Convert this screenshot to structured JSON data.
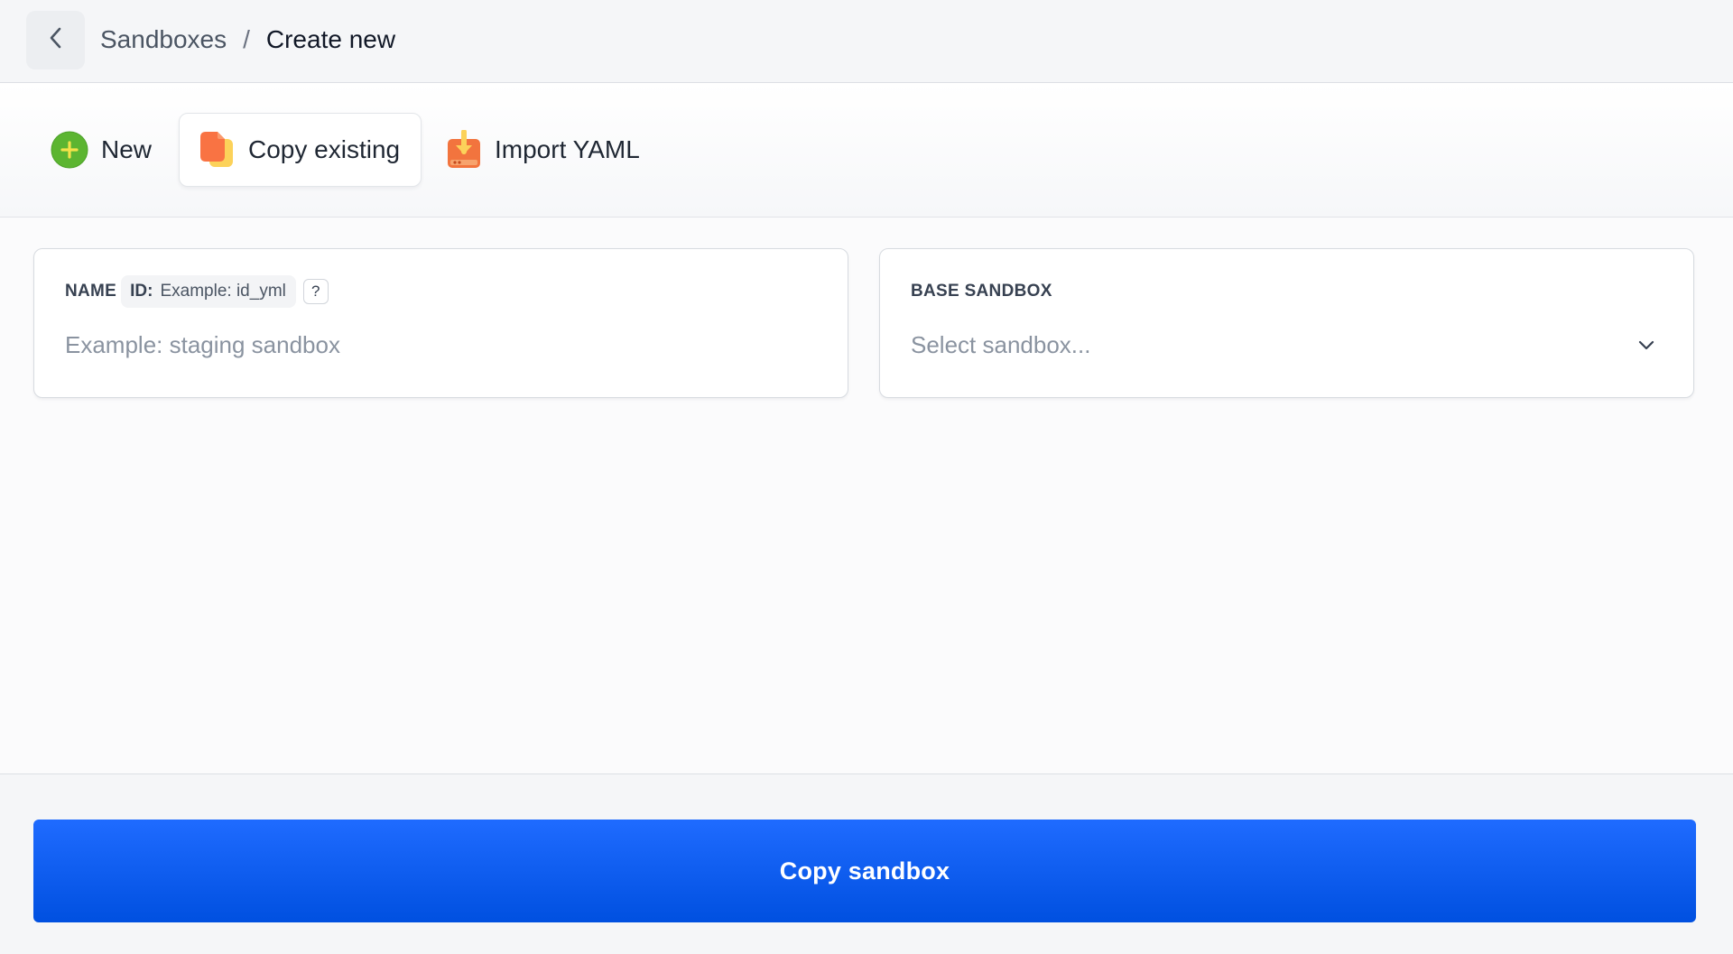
{
  "breadcrumb": {
    "parent": "Sandboxes",
    "separator": "/",
    "current": "Create new"
  },
  "tabs": [
    {
      "label": "New",
      "icon": "plus-circle-icon",
      "selected": false
    },
    {
      "label": "Copy existing",
      "icon": "copy-documents-icon",
      "selected": true
    },
    {
      "label": "Import YAML",
      "icon": "download-tray-icon",
      "selected": false
    }
  ],
  "form": {
    "name": {
      "label": "NAME",
      "id_label": "ID:",
      "id_placeholder": "Example: id_yml",
      "help": "?",
      "placeholder": "Example: staging sandbox",
      "value": ""
    },
    "base_sandbox": {
      "label": "BASE SANDBOX",
      "placeholder": "Select sandbox..."
    }
  },
  "submit_label": "Copy sandbox",
  "colors": {
    "primary": "#0a5cf5",
    "new_icon": "#5cb531",
    "copy_icon": "#f97343",
    "import_icon": "#f2743e"
  }
}
